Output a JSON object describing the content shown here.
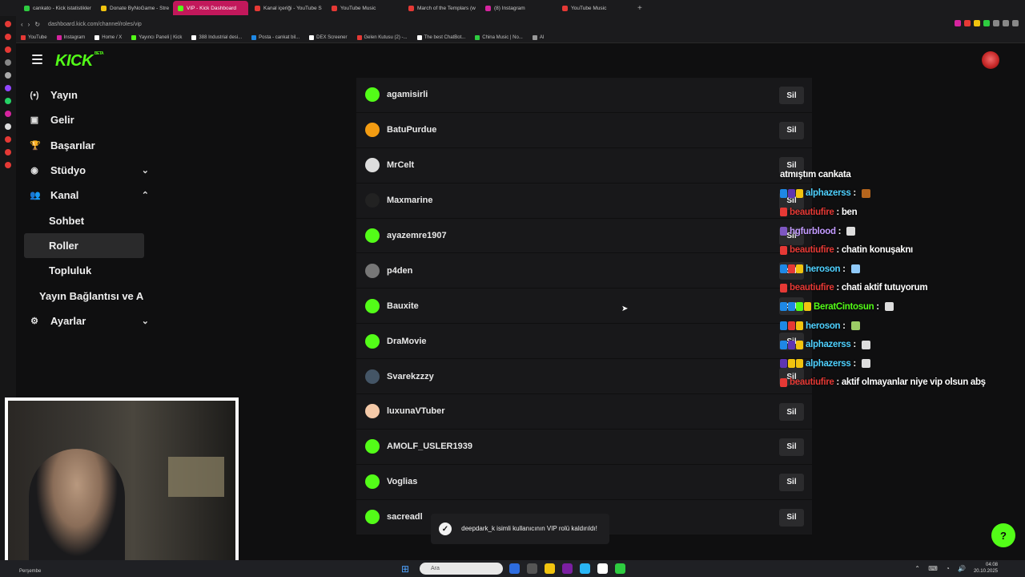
{
  "browser": {
    "tabs": [
      {
        "title": "cankato - Kick istatistikler",
        "color": "#2ecc40"
      },
      {
        "title": "Donate ByNoGame - Stre",
        "color": "#f1c40f"
      },
      {
        "title": "VIP - Kick Dashboard",
        "color": "#53fc18",
        "active": true
      },
      {
        "title": "Kanal içeriği - YouTube S",
        "color": "#e53935"
      },
      {
        "title": "YouTube Music",
        "color": "#e53935"
      },
      {
        "title": "March of the Templars (w",
        "color": "#e53935"
      },
      {
        "title": "(8) Instagram",
        "color": "#d6249f"
      },
      {
        "title": "YouTube Music",
        "color": "#e53935"
      }
    ],
    "url": "dashboard.kick.com/channel/roles/vip",
    "bookmarks": [
      {
        "label": "YouTube",
        "color": "#e53935"
      },
      {
        "label": "Instagram",
        "color": "#d6249f"
      },
      {
        "label": "Home / X",
        "color": "#ffffff"
      },
      {
        "label": "Yayıncı Paneli | Kick",
        "color": "#53fc18"
      },
      {
        "label": "388 Industrial desi...",
        "color": "#ffffff"
      },
      {
        "label": "Posta - cankat bil...",
        "color": "#1e88e5"
      },
      {
        "label": "DEX Screener",
        "color": "#ffffff"
      },
      {
        "label": "Gelen Kutusu (2) -...",
        "color": "#e53935"
      },
      {
        "label": "The best ChatBot...",
        "color": "#ffffff"
      },
      {
        "label": "China Music | No...",
        "color": "#2ecc40"
      },
      {
        "label": "AI",
        "color": "#999999"
      }
    ]
  },
  "app": {
    "logo": "KICK",
    "logo_tag": "BETA",
    "accent": "#53fc18"
  },
  "sidebar": {
    "items": [
      {
        "label": "Yayın",
        "icon": "(•)",
        "icon_name": "broadcast-icon"
      },
      {
        "label": "Gelir",
        "icon": "▣",
        "icon_name": "revenue-icon"
      },
      {
        "label": "Başarılar",
        "icon": "🏆",
        "icon_name": "trophy-icon"
      },
      {
        "label": "Stüdyo",
        "icon": "◉",
        "icon_name": "studio-icon",
        "chevron": "⌄"
      },
      {
        "label": "Kanal",
        "icon": "👥",
        "icon_name": "channel-icon",
        "chevron": "⌃"
      },
      {
        "label": "Sohbet"
      },
      {
        "label": "Roller",
        "active": true
      },
      {
        "label": "Topluluk"
      },
      {
        "label": "Yayın Bağlantısı ve A"
      },
      {
        "label": "Ayarlar",
        "icon": "⚙",
        "icon_name": "gear-icon",
        "chevron": "⌄"
      }
    ]
  },
  "vip_list": {
    "remove_label": "Sil",
    "users": [
      {
        "name": "agamisirli",
        "avatar": "#53fc18"
      },
      {
        "name": "BatuPurdue",
        "avatar": "#f39c12"
      },
      {
        "name": "MrCelt",
        "avatar": "#dddddd"
      },
      {
        "name": "Maxmarine",
        "avatar": "#222222"
      },
      {
        "name": "ayazemre1907",
        "avatar": "#53fc18"
      },
      {
        "name": "p4den",
        "avatar": "#777777"
      },
      {
        "name": "Bauxite",
        "avatar": "#53fc18"
      },
      {
        "name": "DraMovie",
        "avatar": "#53fc18"
      },
      {
        "name": "Svarekzzzy",
        "avatar": "#445566"
      },
      {
        "name": "luxunaVTuber",
        "avatar": "#f4c9a8"
      },
      {
        "name": "AMOLF_USLER1939",
        "avatar": "#53fc18"
      },
      {
        "name": "Voglias",
        "avatar": "#53fc18"
      },
      {
        "name": "sacreadl",
        "avatar": "#53fc18"
      }
    ]
  },
  "toast": {
    "message": "deepdark_k isimli kullanıcının VIP rolü kaldırıldı!",
    "icon": "✓"
  },
  "help_icon": "?",
  "chat": [
    {
      "user": "",
      "user_color": "#ffffff",
      "text": "atmıştım cankata",
      "badges": []
    },
    {
      "user": "alphazerss",
      "user_color": "#4fd1ff",
      "text": " : ",
      "badges": [
        "#1e88e5",
        "#5e35b1",
        "#f1c40f"
      ],
      "emote": "#b5651d"
    },
    {
      "user": "beautiufire",
      "user_color": "#e53935",
      "text": " : ben",
      "badges": [
        "#e53935"
      ]
    },
    {
      "user": "hgfurblood",
      "user_color": "#c39bff",
      "text": " : ",
      "badges": [
        "#7e57c2"
      ],
      "emote": "#dddddd"
    },
    {
      "user": "beautiufire",
      "user_color": "#e53935",
      "text": " : chatin konuşaknı",
      "badges": [
        "#e53935"
      ]
    },
    {
      "user": "heroson",
      "user_color": "#4fd1ff",
      "text": " : ",
      "badges": [
        "#1e88e5",
        "#e53935",
        "#f1c40f"
      ],
      "emote": "#90caf9"
    },
    {
      "user": "beautiufire",
      "user_color": "#e53935",
      "text": " : chati aktif tutuyorum",
      "badges": [
        "#e53935"
      ]
    },
    {
      "user": "BeratCintosun",
      "user_color": "#53fc18",
      "text": " : ",
      "badges": [
        "#1e88e5",
        "#1e88e5",
        "#53fc18",
        "#f1c40f"
      ],
      "emote": "#dddddd"
    },
    {
      "user": "heroson",
      "user_color": "#4fd1ff",
      "text": " : ",
      "badges": [
        "#1e88e5",
        "#e53935",
        "#f1c40f"
      ],
      "emote": "#9ccc65"
    },
    {
      "user": "alphazerss",
      "user_color": "#4fd1ff",
      "text": " : ",
      "badges": [
        "#1e88e5",
        "#5e35b1",
        "#f1c40f"
      ],
      "emote": "#dddddd"
    },
    {
      "user": "alphazerss",
      "user_color": "#4fd1ff",
      "text": " : ",
      "badges": [
        "#5e35b1",
        "#f1c40f",
        "#f1c40f"
      ],
      "emote": "#dddddd"
    },
    {
      "user": "beautiufire",
      "user_color": "#e53935",
      "text": " : aktif olmayanlar niye vip olsun abş",
      "badges": [
        "#e53935"
      ]
    }
  ],
  "taskbar": {
    "weather": "Perşembe",
    "search_placeholder": "Ara",
    "time": "04:08",
    "date": "20.10.2025",
    "apps": [
      "#2d6cdf",
      "#555555",
      "#f1c40f",
      "#7b1fa2",
      "#29b6f6",
      "#ffffff",
      "#2ecc40"
    ]
  }
}
